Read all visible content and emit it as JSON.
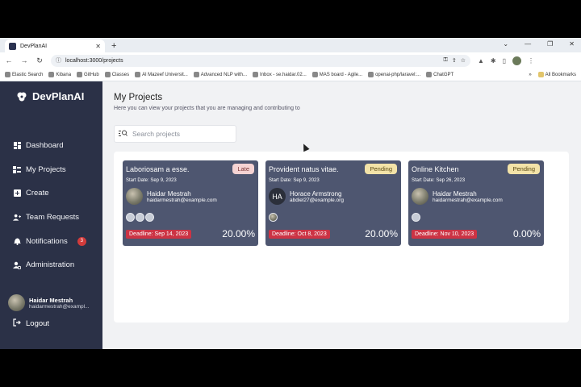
{
  "browser": {
    "tab_title": "DevPlanAI",
    "url": "localhost:3000/projects",
    "bookmarks": [
      "Elastic Search",
      "Kibana",
      "GitHub",
      "Classes",
      "Al Mazeef Universit...",
      "Advanced NLP with...",
      "Inbox - se.haidar.02...",
      "MAS board - Agile...",
      "openai-php/laravel:...",
      "ChatGPT"
    ],
    "all_bookmarks": "All Bookmarks",
    "overflow": "»"
  },
  "app": {
    "name": "DevPlanAI",
    "nav": [
      {
        "label": "Dashboard",
        "icon": "dashboard-icon"
      },
      {
        "label": "My Projects",
        "icon": "projects-icon"
      },
      {
        "label": "Create",
        "icon": "plus-icon"
      },
      {
        "label": "Team Requests",
        "icon": "team-icon"
      },
      {
        "label": "Notifications",
        "icon": "bell-icon",
        "badge": "3"
      },
      {
        "label": "Administration",
        "icon": "admin-icon"
      }
    ],
    "user": {
      "name": "Haidar Mestrah",
      "email": "haidarmestrah@exampl..."
    },
    "logout": "Logout"
  },
  "main": {
    "title": "My Projects",
    "subtitle": "Here you can view your projects that you are managing and contributing to",
    "search_placeholder": "Search projects"
  },
  "projects": [
    {
      "title": "Laboriosam a esse.",
      "status": "Late",
      "start": "Start Date: Sep 9, 2023",
      "owner": "Haidar Mestrah",
      "email": "haidarmestrah@example.com",
      "deadline": "Deadline: Sep 14, 2023",
      "progress": "20.00%"
    },
    {
      "title": "Provident natus vitae.",
      "status": "Pending",
      "start": "Start Date: Sep 9, 2023",
      "owner": "Horace Armstrong",
      "initials": "HA",
      "email": "abdiel27@example.org",
      "deadline": "Deadline: Oct 8, 2023",
      "progress": "20.00%"
    },
    {
      "title": "Online Kitchen",
      "status": "Pending",
      "start": "Start Date: Sep 26, 2023",
      "owner": "Haidar Mestrah",
      "email": "haidarmestrah@example.com",
      "deadline": "Deadline: Nov 10, 2023",
      "progress": "0.00%"
    }
  ],
  "colors": {
    "sidebar": "#2b3147",
    "card": "#4e5670",
    "deadline": "#cc3344",
    "late": "#f5d3d3",
    "pending": "#f3e3a8"
  }
}
